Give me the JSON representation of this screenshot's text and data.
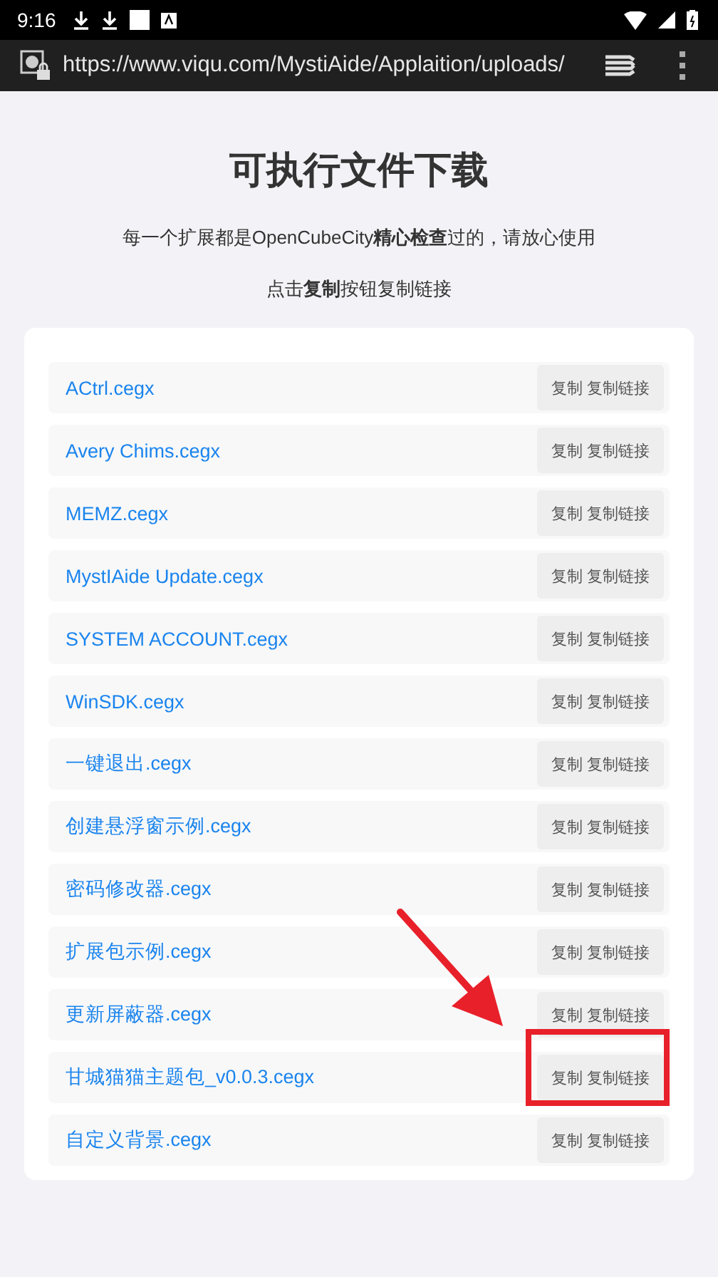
{
  "status_bar": {
    "time": "9:16"
  },
  "browser": {
    "url": "https://www.viqu.com/MystiAide/Applaition/uploads/"
  },
  "page": {
    "title": "可执行文件下载",
    "intro": "每一个扩展都是OpenCubeCity**精心检查**过的，请放心使用",
    "hint": "点击**复制**按钮复制链接"
  },
  "files": [
    {
      "name": "ACtrl.cegx",
      "button": "复制 复制链接",
      "highlighted": false
    },
    {
      "name": "Avery Chims.cegx",
      "button": "复制 复制链接",
      "highlighted": false
    },
    {
      "name": "MEMZ.cegx",
      "button": "复制 复制链接",
      "highlighted": false
    },
    {
      "name": "MystIAide Update.cegx",
      "button": "复制 复制链接",
      "highlighted": false
    },
    {
      "name": "SYSTEM ACCOUNT.cegx",
      "button": "复制 复制链接",
      "highlighted": false
    },
    {
      "name": "WinSDK.cegx",
      "button": "复制 复制链接",
      "highlighted": false
    },
    {
      "name": "一键退出.cegx",
      "button": "复制 复制链接",
      "highlighted": false
    },
    {
      "name": "创建悬浮窗示例.cegx",
      "button": "复制 复制链接",
      "highlighted": false
    },
    {
      "name": "密码修改器.cegx",
      "button": "复制 复制链接",
      "highlighted": false
    },
    {
      "name": "扩展包示例.cegx",
      "button": "复制 复制链接",
      "highlighted": false
    },
    {
      "name": "更新屏蔽器.cegx",
      "button": "复制 复制链接",
      "highlighted": false
    },
    {
      "name": "甘城猫猫主题包_v0.0.3.cegx",
      "button": "复制 复制链接",
      "highlighted": true
    },
    {
      "name": "自定义背景.cegx",
      "button": "复制 复制链接",
      "highlighted": false
    }
  ]
}
